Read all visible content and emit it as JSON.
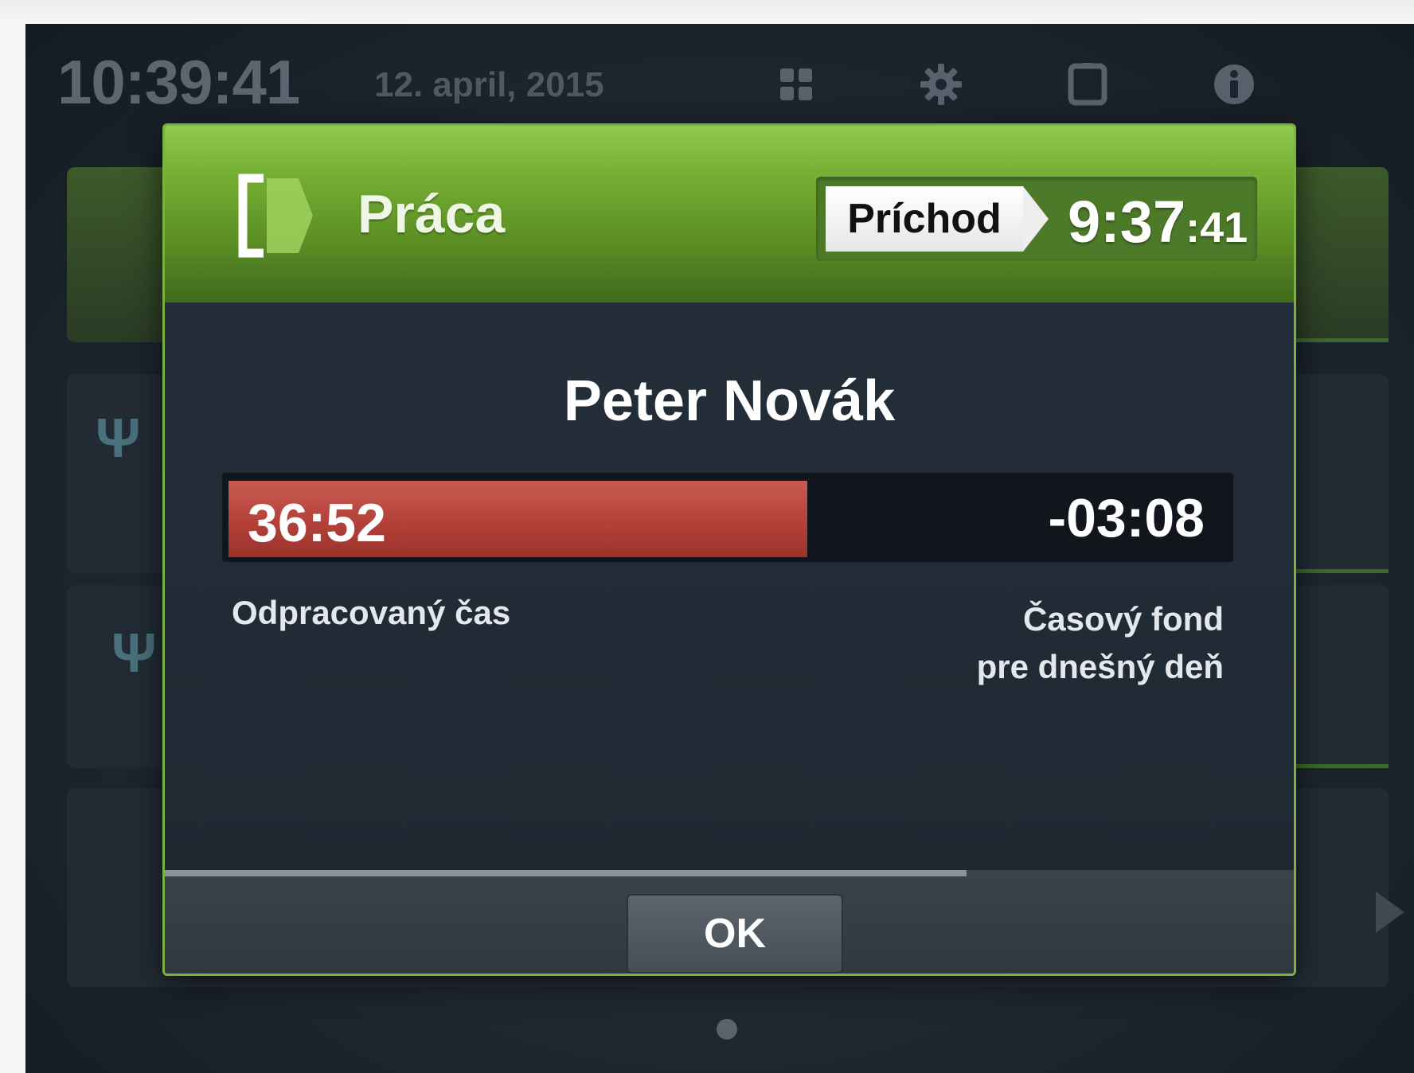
{
  "status_bar": {
    "time": "10:39:41",
    "date": "12. april, 2015",
    "icons": [
      "grid-icon",
      "gear-icon",
      "tablet-icon",
      "info-icon"
    ]
  },
  "dialog": {
    "title": "Práca",
    "event_type": "Príchod",
    "event_time_hm": "9:37",
    "event_time_sec": ":41",
    "employee_name": "Peter Novák",
    "worked_time": "36:52",
    "remaining_time": "-03:08",
    "worked_fraction": 0.58,
    "worked_label": "Odpracovaný čas",
    "fund_label_line1": "Časový fond",
    "fund_label_line2": "pre dnešný deň",
    "timeout_fraction": 0.71,
    "ok_label": "OK"
  },
  "colors": {
    "accent_green": "#7bb23e",
    "progress_red": "#b3413a",
    "screen_bg": "#1d252e"
  }
}
